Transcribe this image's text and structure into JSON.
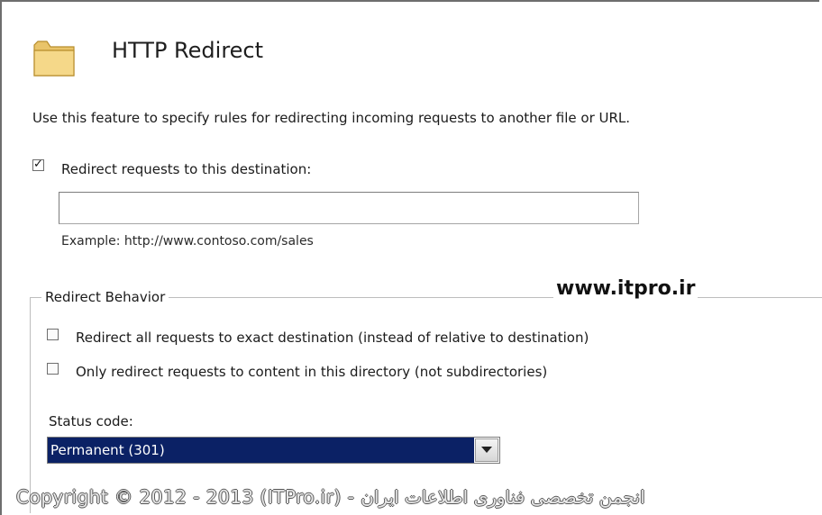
{
  "header": {
    "title": "HTTP Redirect",
    "icon": "folder-icon"
  },
  "description": "Use this feature to specify rules for redirecting incoming requests to another file or URL.",
  "redirect": {
    "checkbox_label": "Redirect requests to this destination:",
    "checked": true,
    "destination_value": "",
    "example": "Example: http://www.contoso.com/sales"
  },
  "behavior": {
    "legend": "Redirect Behavior",
    "options": [
      {
        "label": "Redirect all requests to exact destination (instead of relative to destination)",
        "checked": false
      },
      {
        "label": "Only redirect requests to content in this directory (not subdirectories)",
        "checked": false
      }
    ],
    "status_label": "Status code:",
    "status_value": "Permanent (301)"
  },
  "watermark": {
    "url": "www.itpro.ir",
    "copyright": "Copyright © 2012 - 2013 (ITPro.ir) - انجمن تخصصی فناوری اطلاعات ایران"
  },
  "colors": {
    "selection": "#0b2165",
    "border": "#6e6e6e"
  }
}
